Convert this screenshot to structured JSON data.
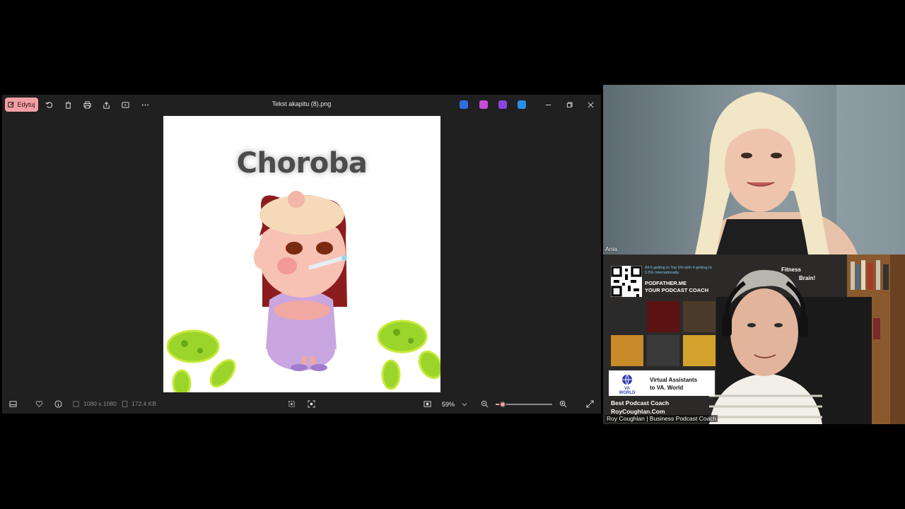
{
  "viewer": {
    "edit_label": "Edytuj",
    "title": "Tekst akapitu (8).png",
    "image_heading": "Choroba",
    "dimensions": "1080 x 1080",
    "file_size": "172.4 KB",
    "zoom": "59%",
    "zoom_fraction": 0.12,
    "app_icon_colors": [
      "#2f6fe0",
      "#c94bd6",
      "#8a44e0",
      "#2a8ee8"
    ]
  },
  "ania": {
    "name": "Ania"
  },
  "roy": {
    "name_tag": "Roy Coughlan | Business Podcast Coach",
    "poster_small": "All 6 getting to Top 5% with 4 getting to 0.5% Internationally",
    "poster_line1": "PODFATHER.ME",
    "poster_line2": "YOUR PODCAST COACH",
    "va_line1": "Virtual Assistants",
    "va_line2": "to VA. World",
    "va_logo": "VA WORLD",
    "best_line1": "Best Podcast Coach",
    "best_line2": "RoyCoughlan.Com",
    "fitness_line1": "Fitness",
    "fitness_line2": "Brain!"
  }
}
